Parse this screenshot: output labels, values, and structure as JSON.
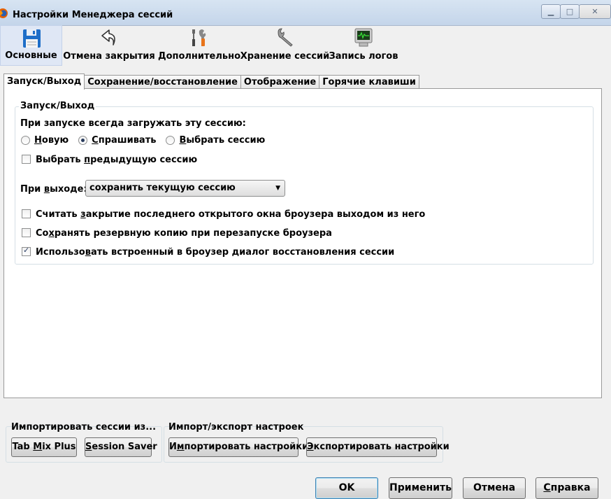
{
  "window": {
    "title": "Настройки Менеджера сессий",
    "controls": {
      "minimize": "▁",
      "maximize": "□",
      "close": "✕"
    }
  },
  "toolbar": {
    "items": [
      {
        "label": "Основные",
        "icon": "floppy-disk-icon",
        "selected": true
      },
      {
        "label": "Отмена закрытия",
        "icon": "undo-arrow-icon",
        "selected": false
      },
      {
        "label": "Дополнительно",
        "icon": "tools-icon",
        "selected": false
      },
      {
        "label": "Хранение сессий",
        "icon": "wrench-icon",
        "selected": false
      },
      {
        "label": "Запись логов",
        "icon": "monitor-log-icon",
        "selected": false
      }
    ]
  },
  "tabs": [
    {
      "label": "Запуск/Выход",
      "active": true
    },
    {
      "label": "Сохранение/восстановление",
      "active": false
    },
    {
      "label": "Отображение",
      "active": false
    },
    {
      "label": "Горячие клавиши",
      "active": false
    }
  ],
  "startup": {
    "group_title": "Запуск/Выход",
    "on_start_label": "При запуске всегда загружать эту сессию:",
    "radios": [
      {
        "label_u": "Н",
        "label_rest": "овую",
        "checked": false
      },
      {
        "label_u": "С",
        "label_rest": "прашивать",
        "checked": true
      },
      {
        "label_u": "В",
        "label_rest": "ыбрать сессию",
        "checked": false
      }
    ],
    "prev_session": {
      "pre": "Выбрать ",
      "u": "п",
      "post": "редыдущую сессию",
      "checked": false
    },
    "on_exit": {
      "pre": "При ",
      "u": "в",
      "post": "ыходе:",
      "selected": "сохранить текущую сессию"
    },
    "checkboxes": [
      {
        "pre": "Считать ",
        "u": "з",
        "post": "акрытие последнего открытого окна броузера выходом из него",
        "checked": false
      },
      {
        "pre": "Со",
        "u": "х",
        "post": "ранять резервную копию при перезапуске броузера",
        "checked": false
      },
      {
        "pre": "Использо",
        "u": "в",
        "post": "ать встроенный в броузер диалог восстановления сессии",
        "checked": true
      }
    ]
  },
  "import_sessions": {
    "title": "Импортировать сессии из...",
    "buttons": [
      {
        "pre": "Tab ",
        "u": "M",
        "post": "ix Plus"
      },
      {
        "pre": "",
        "u": "S",
        "post": "ession Saver"
      }
    ]
  },
  "import_export": {
    "title": "Импорт/экспорт настроек",
    "buttons": [
      {
        "pre": "И",
        "u": "м",
        "post": "портировать настройки"
      },
      {
        "pre": "",
        "u": "Э",
        "post": "кспортировать настройки"
      }
    ]
  },
  "dialog_buttons": {
    "ok": "OK",
    "apply": "Применить",
    "cancel": "Отмена",
    "help_u": "С",
    "help_rest": "правка"
  }
}
